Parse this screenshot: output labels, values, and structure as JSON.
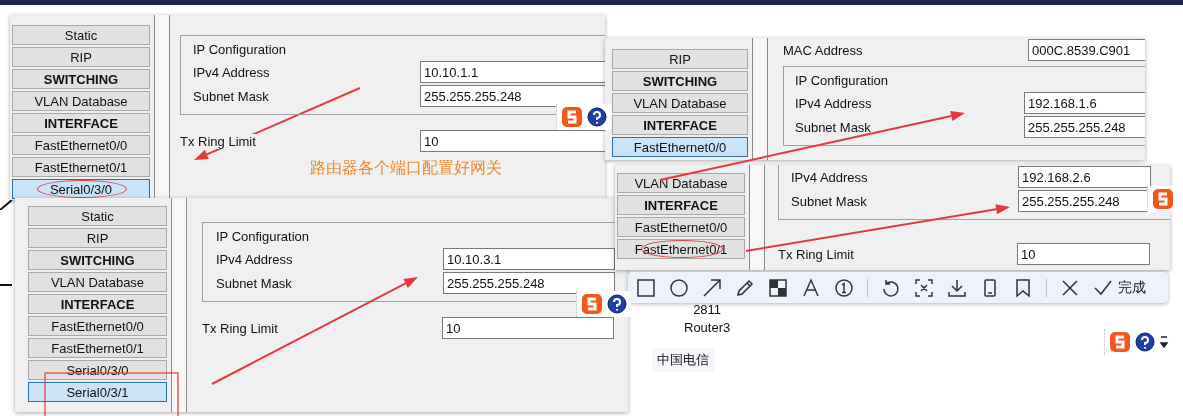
{
  "panels": [
    {
      "sidebar": [
        {
          "label": "Static",
          "kind": "item",
          "selected": false,
          "circled": false
        },
        {
          "label": "RIP",
          "kind": "item",
          "selected": false,
          "circled": false
        },
        {
          "label": "SWITCHING",
          "kind": "header",
          "selected": false,
          "circled": false
        },
        {
          "label": "VLAN Database",
          "kind": "item",
          "selected": false,
          "circled": false
        },
        {
          "label": "INTERFACE",
          "kind": "header",
          "selected": false,
          "circled": false
        },
        {
          "label": "FastEthernet0/0",
          "kind": "item",
          "selected": false,
          "circled": false
        },
        {
          "label": "FastEthernet0/1",
          "kind": "item",
          "selected": false,
          "circled": false
        },
        {
          "label": "Serial0/3/0",
          "kind": "item",
          "selected": true,
          "circled": true
        }
      ],
      "ip_configuration": {
        "title": "IP Configuration",
        "rows": [
          {
            "label": "IPv4 Address",
            "value": "10.10.1.1"
          },
          {
            "label": "Subnet Mask",
            "value": "255.255.255.248"
          }
        ]
      },
      "fields_after": [
        {
          "label": "Tx Ring Limit",
          "value": "10"
        }
      ],
      "note": "路由器各个端口配置好网关"
    },
    {
      "sidebar": [
        {
          "label": "RIP",
          "kind": "item",
          "selected": false,
          "circled": false
        },
        {
          "label": "SWITCHING",
          "kind": "header",
          "selected": false,
          "circled": false
        },
        {
          "label": "VLAN Database",
          "kind": "item",
          "selected": false,
          "circled": false
        },
        {
          "label": "INTERFACE",
          "kind": "header",
          "selected": false,
          "circled": false
        },
        {
          "label": "FastEthernet0/0",
          "kind": "item",
          "selected": true,
          "circled": false
        }
      ],
      "fields_before": [
        {
          "label": "MAC Address",
          "value": "000C.8539.C901"
        }
      ],
      "ip_configuration": {
        "title": "IP Configuration",
        "rows": [
          {
            "label": "IPv4 Address",
            "value": "192.168.1.6"
          },
          {
            "label": "Subnet Mask",
            "value": "255.255.255.248"
          }
        ]
      }
    },
    {
      "sidebar": [
        {
          "label": "VLAN Database",
          "kind": "item",
          "selected": false,
          "circled": false
        },
        {
          "label": "INTERFACE",
          "kind": "header",
          "selected": false,
          "circled": false
        },
        {
          "label": "FastEthernet0/0",
          "kind": "item",
          "selected": false,
          "circled": false
        },
        {
          "label": "FastEthernet0/1",
          "kind": "item",
          "selected": false,
          "circled": true
        }
      ],
      "ip_configuration": {
        "rows": [
          {
            "label": "IPv4 Address",
            "value": "192.168.2.6"
          },
          {
            "label": "Subnet Mask",
            "value": "255.255.255.248"
          }
        ]
      },
      "fields_after": [
        {
          "label": "Tx Ring Limit",
          "value": "10"
        }
      ]
    },
    {
      "sidebar": [
        {
          "label": "Static",
          "kind": "item",
          "selected": false,
          "circled": false
        },
        {
          "label": "RIP",
          "kind": "item",
          "selected": false,
          "circled": false
        },
        {
          "label": "SWITCHING",
          "kind": "header",
          "selected": false,
          "circled": false
        },
        {
          "label": "VLAN Database",
          "kind": "item",
          "selected": false,
          "circled": false
        },
        {
          "label": "INTERFACE",
          "kind": "header",
          "selected": false,
          "circled": false
        },
        {
          "label": "FastEthernet0/0",
          "kind": "item",
          "selected": false,
          "circled": false
        },
        {
          "label": "FastEthernet0/1",
          "kind": "item",
          "selected": false,
          "circled": false
        },
        {
          "label": "Serial0/3/0",
          "kind": "item",
          "selected": false,
          "circled": false
        },
        {
          "label": "Serial0/3/1",
          "kind": "item",
          "selected": true,
          "circled": false
        }
      ],
      "ip_configuration": {
        "title": "IP Configuration",
        "rows": [
          {
            "label": "IPv4 Address",
            "value": "10.10.3.1"
          },
          {
            "label": "Subnet Mask",
            "value": "255.255.255.248"
          }
        ]
      },
      "fields_after": [
        {
          "label": "Tx Ring Limit",
          "value": "10"
        }
      ]
    }
  ],
  "device": {
    "model": "2811",
    "name": "Router3"
  },
  "cloud_label": "中国电信",
  "annotation_toolbar": {
    "tools": [
      {
        "kind": "rectangle"
      },
      {
        "kind": "ellipse"
      },
      {
        "kind": "arrow"
      },
      {
        "kind": "pencil"
      },
      {
        "kind": "mosaic"
      },
      {
        "kind": "text"
      },
      {
        "kind": "number"
      },
      {
        "kind": "divider"
      },
      {
        "kind": "undo"
      },
      {
        "kind": "recognize"
      },
      {
        "kind": "download"
      },
      {
        "kind": "phone"
      },
      {
        "kind": "pin"
      },
      {
        "kind": "divider"
      },
      {
        "kind": "close"
      }
    ],
    "done_label": "完成"
  }
}
